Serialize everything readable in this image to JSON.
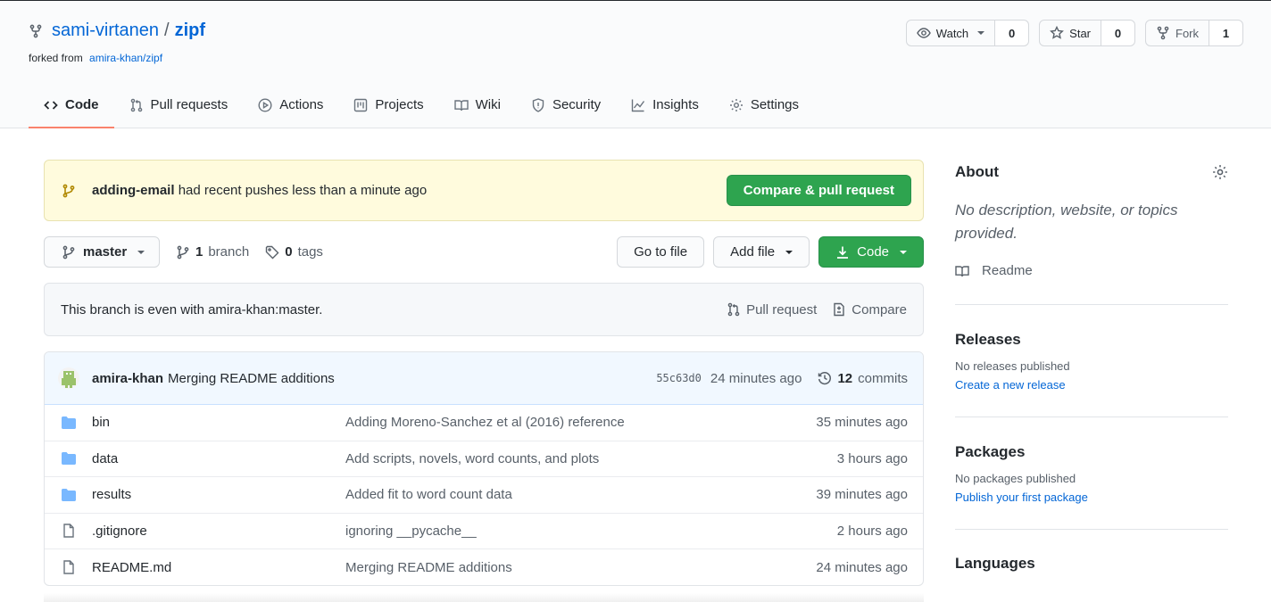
{
  "repo": {
    "owner": "sami-virtanen",
    "separator": "/",
    "name": "zipf",
    "forked_from_label": "forked from",
    "forked_from": "amira-khan/zipf"
  },
  "actions": {
    "watch": {
      "label": "Watch",
      "count": "0"
    },
    "star": {
      "label": "Star",
      "count": "0"
    },
    "fork": {
      "label": "Fork",
      "count": "1"
    }
  },
  "tabs": [
    {
      "label": "Code",
      "icon": "code-icon",
      "active": true
    },
    {
      "label": "Pull requests",
      "icon": "pull-request-icon"
    },
    {
      "label": "Actions",
      "icon": "play-icon"
    },
    {
      "label": "Projects",
      "icon": "project-icon"
    },
    {
      "label": "Wiki",
      "icon": "book-icon"
    },
    {
      "label": "Security",
      "icon": "shield-icon"
    },
    {
      "label": "Insights",
      "icon": "graph-icon"
    },
    {
      "label": "Settings",
      "icon": "gear-icon"
    }
  ],
  "flash": {
    "branch": "adding-email",
    "message": "had recent pushes less than a minute ago",
    "button": "Compare & pull request"
  },
  "filebar": {
    "branch": "master",
    "branch_count": "1",
    "branch_label": "branch",
    "tag_count": "0",
    "tag_label": "tags",
    "go_to_file": "Go to file",
    "add_file": "Add file",
    "code": "Code"
  },
  "branch_status": {
    "text": "This branch is even with amira-khan:master.",
    "pull_request": "Pull request",
    "compare": "Compare"
  },
  "latest_commit": {
    "author": "amira-khan",
    "message": "Merging README additions",
    "sha": "55c63d0",
    "when": "24 minutes ago",
    "commit_count": "12",
    "commit_label": "commits"
  },
  "files": [
    {
      "type": "dir",
      "name": "bin",
      "message": "Adding Moreno-Sanchez et al (2016) reference",
      "age": "35 minutes ago"
    },
    {
      "type": "dir",
      "name": "data",
      "message": "Add scripts, novels, word counts, and plots",
      "age": "3 hours ago"
    },
    {
      "type": "dir",
      "name": "results",
      "message": "Added fit to word count data",
      "age": "39 minutes ago"
    },
    {
      "type": "file",
      "name": ".gitignore",
      "message": "ignoring __pycache__",
      "age": "2 hours ago"
    },
    {
      "type": "file",
      "name": "README.md",
      "message": "Merging README additions",
      "age": "24 minutes ago"
    }
  ],
  "sidebar": {
    "about": {
      "title": "About",
      "description": "No description, website, or topics provided.",
      "readme": "Readme"
    },
    "releases": {
      "title": "Releases",
      "note": "No releases published",
      "link": "Create a new release"
    },
    "packages": {
      "title": "Packages",
      "note": "No packages published",
      "link": "Publish your first package"
    },
    "languages": {
      "title": "Languages"
    }
  },
  "colors": {
    "accent_link": "#0366d6",
    "primary_green": "#2ea44f",
    "active_tab_underline": "#f9826c",
    "flash_bg": "#fffbdd",
    "folder_blue": "#79b8ff"
  }
}
